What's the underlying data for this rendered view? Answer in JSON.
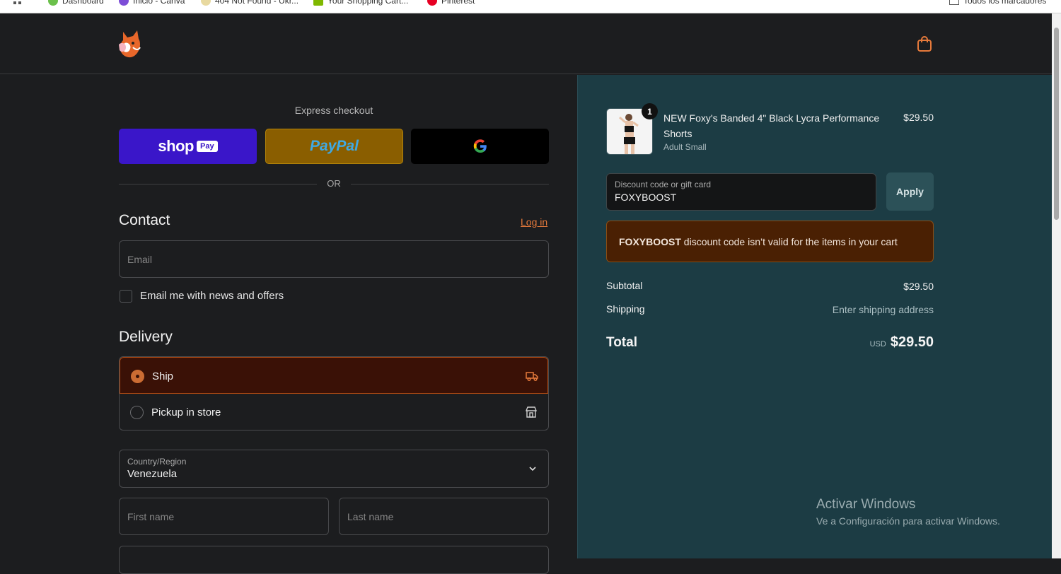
{
  "bookmarks": [
    {
      "label": "Dashboard",
      "color": "#6bc04b"
    },
    {
      "label": "Inicio - Canva",
      "color": "#7d4dd7"
    },
    {
      "label": "404 Not Found - Ukr...",
      "color": "#e8d9a0"
    },
    {
      "label": "Your Shopping Cart...",
      "color": "#7fb800"
    },
    {
      "label": "Pinterest",
      "color": "#e60023"
    }
  ],
  "bookmarks_right": "Todos los marcadores",
  "header": {
    "logo_icon": "fox-logo-icon",
    "cart_icon": "shopping-bag-icon"
  },
  "express": {
    "title": "Express checkout",
    "shop_label": "shop",
    "shop_pill": "Pay",
    "paypal_label": "PayPal",
    "google_icon": "google-g-icon",
    "or_label": "OR"
  },
  "contact": {
    "title": "Contact",
    "login_label": "Log in",
    "email_placeholder": "Email",
    "newsletter_label": "Email me with news and offers"
  },
  "delivery": {
    "title": "Delivery",
    "options": [
      {
        "label": "Ship",
        "selected": true,
        "icon": "truck-icon"
      },
      {
        "label": "Pickup in store",
        "selected": false,
        "icon": "store-icon"
      }
    ],
    "country_label": "Country/Region",
    "country_value": "Venezuela",
    "first_name_placeholder": "First name",
    "last_name_placeholder": "Last name"
  },
  "summary": {
    "product": {
      "quantity": "1",
      "name": "NEW Foxy's Banded 4\" Black Lycra Performance Shorts",
      "variant": "Adult Small",
      "price": "$29.50"
    },
    "discount_label": "Discount code or gift card",
    "discount_value": "FOXYBOOST",
    "apply_label": "Apply",
    "error_code": "FOXYBOOST",
    "error_message": " discount code isn’t valid for the items in your cart",
    "subtotal_label": "Subtotal",
    "subtotal_value": "$29.50",
    "shipping_label": "Shipping",
    "shipping_value": "Enter shipping address",
    "total_label": "Total",
    "total_currency": "USD",
    "total_value": "$29.50"
  },
  "watermark": {
    "title": "Activar Windows",
    "subtitle": "Ve a Configuración para activar Windows."
  },
  "colors": {
    "accent": "#e67a3b",
    "summary_bg": "#1c3c44",
    "shop_pay": "#3a16c9",
    "paypal": "#8a5e00",
    "error_bg": "#4a2003"
  }
}
